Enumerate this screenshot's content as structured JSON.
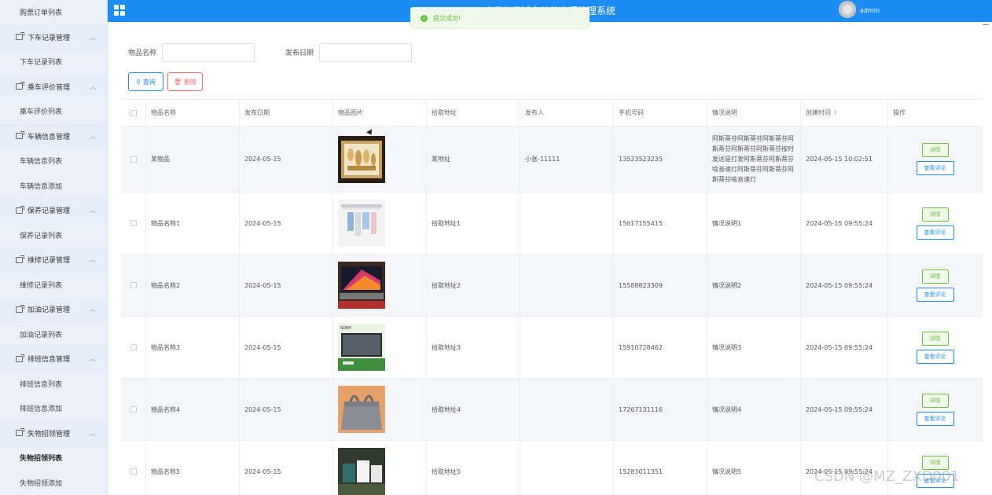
{
  "header": {
    "system_title": "欢迎使用城市公共交通管理系统",
    "admin_name": "admin"
  },
  "toast": {
    "message": "提交成功!",
    "color": "#67c23a"
  },
  "sidebar": {
    "items": [
      {
        "type": "sub",
        "label": "购票订单列表"
      },
      {
        "type": "group",
        "label": "下车记录管理"
      },
      {
        "type": "sub",
        "label": "下车记录列表"
      },
      {
        "type": "group",
        "label": "乘车评价管理"
      },
      {
        "type": "sub",
        "label": "乘车评价列表"
      },
      {
        "type": "group",
        "label": "车辆信息管理"
      },
      {
        "type": "sub",
        "label": "车辆信息列表"
      },
      {
        "type": "sub",
        "label": "车辆信息添加"
      },
      {
        "type": "group",
        "label": "保养记录管理"
      },
      {
        "type": "sub",
        "label": "保养记录列表"
      },
      {
        "type": "group",
        "label": "维修记录管理"
      },
      {
        "type": "sub",
        "label": "维修记录列表"
      },
      {
        "type": "group",
        "label": "加油记录管理"
      },
      {
        "type": "sub",
        "label": "加油记录列表"
      },
      {
        "type": "group",
        "label": "排班信息管理"
      },
      {
        "type": "sub",
        "label": "排班信息列表"
      },
      {
        "type": "sub",
        "label": "排班信息添加"
      },
      {
        "type": "group",
        "label": "失物招领管理"
      },
      {
        "type": "sub",
        "label": "失物招领列表",
        "active": true
      },
      {
        "type": "sub",
        "label": "失物招领添加"
      }
    ]
  },
  "search": {
    "item_name_label": "物品名称",
    "publish_date_label": "发布日期",
    "query_button": "查询",
    "delete_button": "删除"
  },
  "table": {
    "columns": [
      "物品名称",
      "发布日期",
      "物品图片",
      "拾取地址",
      "发布人",
      "手机号码",
      "情况说明",
      "创建时间",
      "操作"
    ],
    "detail_button": "详情",
    "review_button": "查看评论",
    "rows": [
      {
        "name": "某物品",
        "date": "2024-05-15",
        "image": "thumb-giftbox",
        "address": "某地址",
        "publisher": "小张-11111",
        "phone": "13523523235",
        "desc": "阿斯蒂芬阿斯蒂芬阿斯蒂芬阿斯蒂芬阿斯蒂芬阿斯蒂芬按时发达是打发阿斯蒂芬阿斯蒂芬啥音速灯阿斯蒂芬阿斯蒂芬阿斯蒂芬啥音速灯",
        "created": "2024-05-15 10:02:51"
      },
      {
        "name": "物品名称1",
        "date": "2024-05-15",
        "image": "thumb-rack",
        "address": "拾取地址1",
        "publisher": "",
        "phone": "15617155415",
        "desc": "情况说明1",
        "created": "2024-05-15 09:55:24"
      },
      {
        "name": "物品名称2",
        "date": "2024-05-15",
        "image": "thumb-laptop",
        "address": "拾取地址2",
        "publisher": "",
        "phone": "15588823309",
        "desc": "情况说明2",
        "created": "2024-05-15 09:55:24"
      },
      {
        "name": "物品名称3",
        "date": "2024-05-15",
        "image": "thumb-tv",
        "address": "拾取地址3",
        "publisher": "",
        "phone": "15910728462",
        "desc": "情况说明3",
        "created": "2024-05-15 09:55:24"
      },
      {
        "name": "物品名称4",
        "date": "2024-05-15",
        "image": "thumb-bag",
        "address": "拾取地址4",
        "publisher": "",
        "phone": "17267131116",
        "desc": "情况说明4",
        "created": "2024-05-15 09:55:24"
      },
      {
        "name": "物品名称5",
        "date": "2024-05-15",
        "image": "thumb-mugs",
        "address": "拾取地址5",
        "publisher": "",
        "phone": "15283011351",
        "desc": "情况说明5",
        "created": "2024-05-15 09:55:24"
      }
    ]
  },
  "thumb_tv_brand": "SONY",
  "watermark": "CSDN @MZ_ZXD001",
  "colors": {
    "header_blue": "#1e8df3",
    "sidebar_bg": "#eaf1fa",
    "success_green": "#67c23a",
    "danger_red": "#f56c6c"
  }
}
